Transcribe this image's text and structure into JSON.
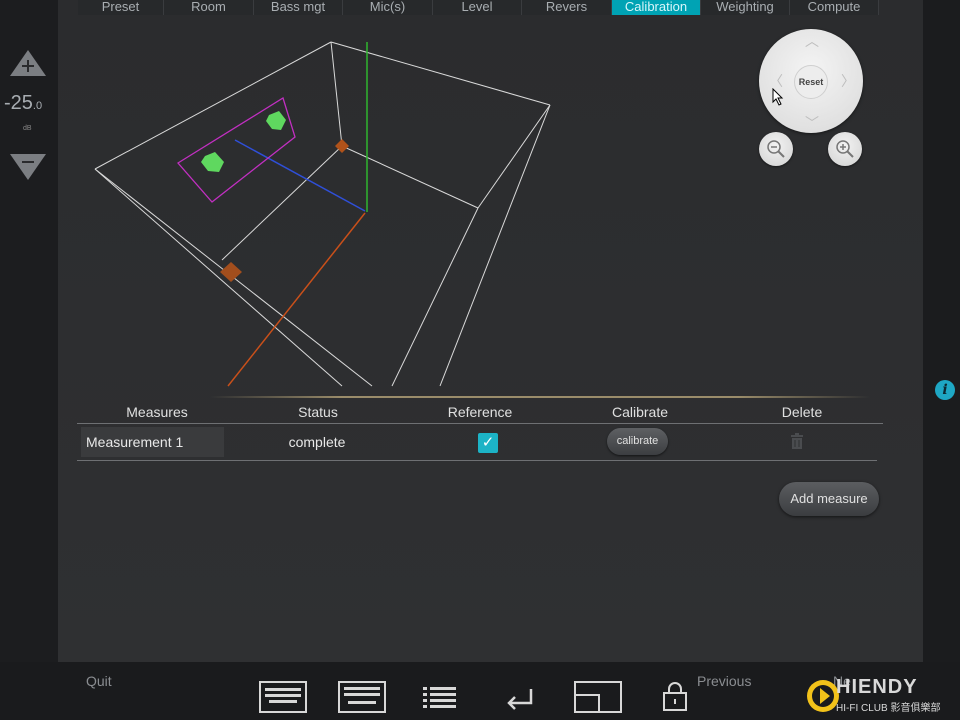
{
  "tabs": [
    {
      "label": "Preset",
      "active": false
    },
    {
      "label": "Room",
      "active": false
    },
    {
      "label": "Bass mgt",
      "active": false
    },
    {
      "label": "Mic(s)",
      "active": false
    },
    {
      "label": "Level",
      "active": false
    },
    {
      "label": "Revers",
      "active": false
    },
    {
      "label": "Calibration",
      "active": true
    },
    {
      "label": "Weighting",
      "active": false
    },
    {
      "label": "Compute",
      "active": false
    }
  ],
  "volume": {
    "value": "-25",
    "decimal": ".0",
    "unit": "dB"
  },
  "view": {
    "reset_label": "Reset"
  },
  "table": {
    "headers": {
      "measures": "Measures",
      "status": "Status",
      "reference": "Reference",
      "calibrate": "Calibrate",
      "delete": "Delete"
    },
    "rows": [
      {
        "name": "Measurement 1",
        "status": "complete",
        "reference_checked": true,
        "calibrate_label": "calibrate"
      }
    ]
  },
  "add_measure_label": "Add measure",
  "bottom": {
    "quit": "Quit",
    "previous": "Previous",
    "next": "Ne"
  },
  "brand": {
    "name": "HIENDY",
    "sub": "HI-FI CLUB 影音俱樂部"
  },
  "colors": {
    "accent": "#00a3b4",
    "checkbox": "#1cb3c6",
    "info": "#1ea7c4"
  },
  "icons": [
    "plus-icon",
    "minus-icon",
    "zoom-out-icon",
    "zoom-in-icon",
    "trash-icon",
    "info-icon",
    "keyboard-icon",
    "list-icon",
    "enter-icon",
    "window-icon",
    "lock-icon"
  ]
}
